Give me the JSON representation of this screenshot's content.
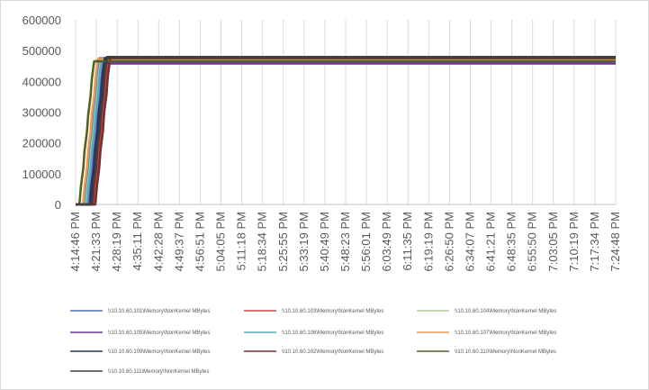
{
  "chart_data": {
    "type": "line",
    "title": "",
    "xlabel": "",
    "ylabel": "",
    "ylim": [
      0,
      600000
    ],
    "yticks": [
      0,
      100000,
      200000,
      300000,
      400000,
      500000,
      600000
    ],
    "ytick_labels": [
      "0",
      "100000",
      "200000",
      "300000",
      "400000",
      "500000",
      "600000"
    ],
    "x_ticks": [
      "4:14:46 PM",
      "4:21:33 PM",
      "4:28:19 PM",
      "4:35:11 PM",
      "4:42:28 PM",
      "4:49:37 PM",
      "4:56:51 PM",
      "5:04:05 PM",
      "5:11:18 PM",
      "5:18:34 PM",
      "5:25:55 PM",
      "5:33:19 PM",
      "5:40:49 PM",
      "5:48:23 PM",
      "5:56:01 PM",
      "6:03:49 PM",
      "6:11:35 PM",
      "6:19:19 PM",
      "6:26:50 PM",
      "6:34:07 PM",
      "6:41:21 PM",
      "6:48:35 PM",
      "6:55:50 PM",
      "7:03:05 PM",
      "7:10:19 PM",
      "7:17:34 PM",
      "7:24:48 PM"
    ],
    "grid": "vertical",
    "legend_position": "bottom",
    "series": [
      {
        "name": "\\\\10.10.60.101\\Memory\\NonKernel MBytes",
        "color": "#4472c4",
        "ramp_start": 0.44,
        "ramp_end": 1.14,
        "plateau": 475000
      },
      {
        "name": "\\\\10.10.60.103\\Memory\\NonKernel MBytes",
        "color": "#ed3e3e",
        "ramp_start": 0.9,
        "ramp_end": 1.6,
        "plateau": 478000
      },
      {
        "name": "\\\\10.10.60.104\\Memory\\NonKernel MBytes",
        "color": "#a9d18e",
        "ramp_start": 0.5,
        "ramp_end": 1.2,
        "plateau": 468000
      },
      {
        "name": "\\\\10.10.60.105\\Memory\\NonKernel MBytes",
        "color": "#7030a0",
        "ramp_start": 0.6,
        "ramp_end": 1.3,
        "plateau": 458000
      },
      {
        "name": "\\\\10.10.60.106\\Memory\\NonKernel MBytes",
        "color": "#4bacc6",
        "ramp_start": 0.55,
        "ramp_end": 1.25,
        "plateau": 470000
      },
      {
        "name": "\\\\10.10.60.107\\Memory\\NonKernel MBytes",
        "color": "#f79646",
        "ramp_start": 0.36,
        "ramp_end": 1.06,
        "plateau": 472000
      },
      {
        "name": "\\\\10.10.60.109\\Memory\\NonKernel MBytes",
        "color": "#1f3864",
        "ramp_start": 0.7,
        "ramp_end": 1.4,
        "plateau": 476000
      },
      {
        "name": "\\\\10.10.60.102\\Memory\\NonKernel MBytes",
        "color": "#7b2c2c",
        "ramp_start": 0.95,
        "ramp_end": 1.65,
        "plateau": 477000
      },
      {
        "name": "\\\\10.10.60.110\\Memory\\NonKernel MBytes",
        "color": "#4f6228",
        "ramp_start": 0.18,
        "ramp_end": 0.88,
        "plateau": 465000
      },
      {
        "name": "\\\\10.10.60.111\\Memory\\NonKernel MBytes",
        "color": "#404040",
        "ramp_start": 0.8,
        "ramp_end": 1.5,
        "plateau": 479000
      }
    ]
  }
}
